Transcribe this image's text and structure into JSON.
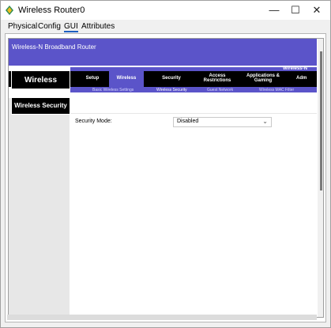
{
  "window": {
    "title": "Wireless Router0",
    "controls": {
      "minimize": "—",
      "maximize": "☐",
      "close": "✕"
    }
  },
  "tabs": [
    {
      "label": "Physical"
    },
    {
      "label": "Config"
    },
    {
      "label": "GUI",
      "active": true
    },
    {
      "label": "Attributes"
    }
  ],
  "router": {
    "banner_title": "Wireless-N Broadband Router",
    "model_label": "Wireless-N",
    "section_label": "Wireless",
    "menu": [
      {
        "label": "Setup"
      },
      {
        "label": "Wireless",
        "active": true
      },
      {
        "label": "Security"
      },
      {
        "label": "Access Restrictions"
      },
      {
        "label": "Applications & Gaming"
      },
      {
        "label": "Adm"
      }
    ],
    "submenu": [
      {
        "label": "Basic Wireless Settings"
      },
      {
        "label": "Wireless Security",
        "active": true
      },
      {
        "label": "Guest Network"
      },
      {
        "label": "Wireless MAC Filter"
      }
    ],
    "subsection_title": "Wireless Security",
    "security_mode_label": "Security Mode:",
    "security_mode_value": "Disabled"
  },
  "colors": {
    "banner": "#5b54c9",
    "menu_bg": "#000000",
    "active_tab_underline": "#1e5fc0"
  }
}
